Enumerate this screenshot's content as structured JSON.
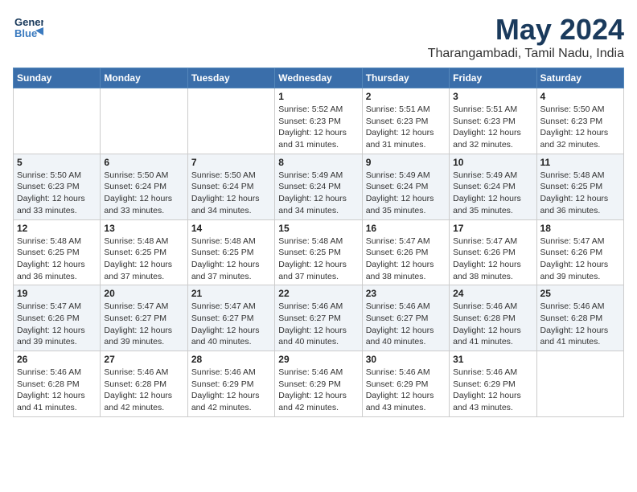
{
  "header": {
    "logo_line1": "General",
    "logo_line2": "Blue",
    "title": "May 2024",
    "subtitle": "Tharangambadi, Tamil Nadu, India"
  },
  "days_of_week": [
    "Sunday",
    "Monday",
    "Tuesday",
    "Wednesday",
    "Thursday",
    "Friday",
    "Saturday"
  ],
  "weeks": [
    [
      {
        "day": "",
        "info": ""
      },
      {
        "day": "",
        "info": ""
      },
      {
        "day": "",
        "info": ""
      },
      {
        "day": "1",
        "info": "Sunrise: 5:52 AM\nSunset: 6:23 PM\nDaylight: 12 hours and 31 minutes."
      },
      {
        "day": "2",
        "info": "Sunrise: 5:51 AM\nSunset: 6:23 PM\nDaylight: 12 hours and 31 minutes."
      },
      {
        "day": "3",
        "info": "Sunrise: 5:51 AM\nSunset: 6:23 PM\nDaylight: 12 hours and 32 minutes."
      },
      {
        "day": "4",
        "info": "Sunrise: 5:50 AM\nSunset: 6:23 PM\nDaylight: 12 hours and 32 minutes."
      }
    ],
    [
      {
        "day": "5",
        "info": "Sunrise: 5:50 AM\nSunset: 6:23 PM\nDaylight: 12 hours and 33 minutes."
      },
      {
        "day": "6",
        "info": "Sunrise: 5:50 AM\nSunset: 6:24 PM\nDaylight: 12 hours and 33 minutes."
      },
      {
        "day": "7",
        "info": "Sunrise: 5:50 AM\nSunset: 6:24 PM\nDaylight: 12 hours and 34 minutes."
      },
      {
        "day": "8",
        "info": "Sunrise: 5:49 AM\nSunset: 6:24 PM\nDaylight: 12 hours and 34 minutes."
      },
      {
        "day": "9",
        "info": "Sunrise: 5:49 AM\nSunset: 6:24 PM\nDaylight: 12 hours and 35 minutes."
      },
      {
        "day": "10",
        "info": "Sunrise: 5:49 AM\nSunset: 6:24 PM\nDaylight: 12 hours and 35 minutes."
      },
      {
        "day": "11",
        "info": "Sunrise: 5:48 AM\nSunset: 6:25 PM\nDaylight: 12 hours and 36 minutes."
      }
    ],
    [
      {
        "day": "12",
        "info": "Sunrise: 5:48 AM\nSunset: 6:25 PM\nDaylight: 12 hours and 36 minutes."
      },
      {
        "day": "13",
        "info": "Sunrise: 5:48 AM\nSunset: 6:25 PM\nDaylight: 12 hours and 37 minutes."
      },
      {
        "day": "14",
        "info": "Sunrise: 5:48 AM\nSunset: 6:25 PM\nDaylight: 12 hours and 37 minutes."
      },
      {
        "day": "15",
        "info": "Sunrise: 5:48 AM\nSunset: 6:25 PM\nDaylight: 12 hours and 37 minutes."
      },
      {
        "day": "16",
        "info": "Sunrise: 5:47 AM\nSunset: 6:26 PM\nDaylight: 12 hours and 38 minutes."
      },
      {
        "day": "17",
        "info": "Sunrise: 5:47 AM\nSunset: 6:26 PM\nDaylight: 12 hours and 38 minutes."
      },
      {
        "day": "18",
        "info": "Sunrise: 5:47 AM\nSunset: 6:26 PM\nDaylight: 12 hours and 39 minutes."
      }
    ],
    [
      {
        "day": "19",
        "info": "Sunrise: 5:47 AM\nSunset: 6:26 PM\nDaylight: 12 hours and 39 minutes."
      },
      {
        "day": "20",
        "info": "Sunrise: 5:47 AM\nSunset: 6:27 PM\nDaylight: 12 hours and 39 minutes."
      },
      {
        "day": "21",
        "info": "Sunrise: 5:47 AM\nSunset: 6:27 PM\nDaylight: 12 hours and 40 minutes."
      },
      {
        "day": "22",
        "info": "Sunrise: 5:46 AM\nSunset: 6:27 PM\nDaylight: 12 hours and 40 minutes."
      },
      {
        "day": "23",
        "info": "Sunrise: 5:46 AM\nSunset: 6:27 PM\nDaylight: 12 hours and 40 minutes."
      },
      {
        "day": "24",
        "info": "Sunrise: 5:46 AM\nSunset: 6:28 PM\nDaylight: 12 hours and 41 minutes."
      },
      {
        "day": "25",
        "info": "Sunrise: 5:46 AM\nSunset: 6:28 PM\nDaylight: 12 hours and 41 minutes."
      }
    ],
    [
      {
        "day": "26",
        "info": "Sunrise: 5:46 AM\nSunset: 6:28 PM\nDaylight: 12 hours and 41 minutes."
      },
      {
        "day": "27",
        "info": "Sunrise: 5:46 AM\nSunset: 6:28 PM\nDaylight: 12 hours and 42 minutes."
      },
      {
        "day": "28",
        "info": "Sunrise: 5:46 AM\nSunset: 6:29 PM\nDaylight: 12 hours and 42 minutes."
      },
      {
        "day": "29",
        "info": "Sunrise: 5:46 AM\nSunset: 6:29 PM\nDaylight: 12 hours and 42 minutes."
      },
      {
        "day": "30",
        "info": "Sunrise: 5:46 AM\nSunset: 6:29 PM\nDaylight: 12 hours and 43 minutes."
      },
      {
        "day": "31",
        "info": "Sunrise: 5:46 AM\nSunset: 6:29 PM\nDaylight: 12 hours and 43 minutes."
      },
      {
        "day": "",
        "info": ""
      }
    ]
  ]
}
